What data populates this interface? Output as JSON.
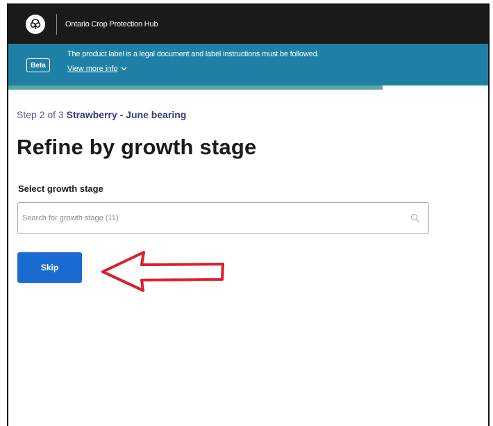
{
  "header": {
    "site_title": "Ontario Crop Protection Hub",
    "logo_icon": "ontario-trillium-icon"
  },
  "banner": {
    "badge": "Beta",
    "message": "The product label is a legal document and label instructions must be followed.",
    "link_label": "View more info",
    "link_icon": "chevron-down-icon",
    "color": "#1f80a6"
  },
  "progress": {
    "fraction": 0.78,
    "color": "#5aa8a6"
  },
  "step": {
    "prefix": "Step 2 of 3",
    "crop": "Strawberry - June bearing"
  },
  "page": {
    "title": "Refine by growth stage"
  },
  "growth_stage": {
    "label": "Select growth stage",
    "placeholder": "Search for growth stage (11)",
    "value": ""
  },
  "actions": {
    "skip_label": "Skip",
    "skip_color": "#1a6bd0"
  },
  "annotation": {
    "arrow_color": "#d9202a"
  }
}
